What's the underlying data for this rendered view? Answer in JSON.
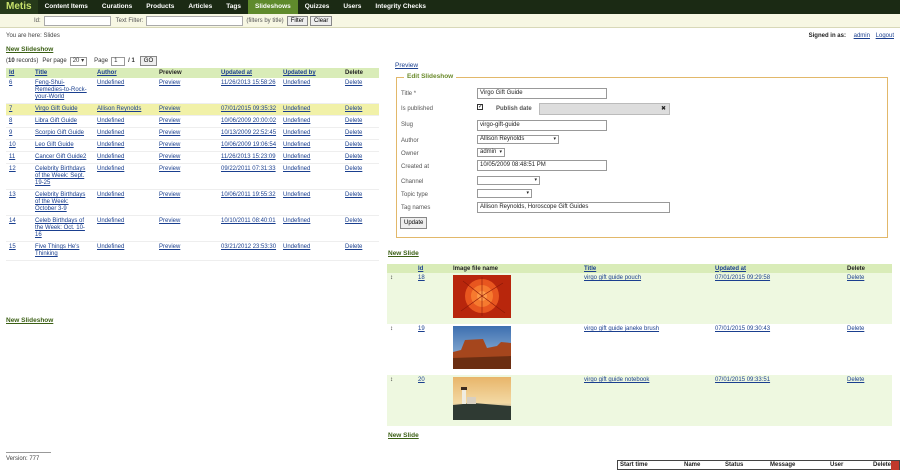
{
  "nav": {
    "brand": "Metis",
    "items": [
      "Content Items",
      "Curations",
      "Products",
      "Articles",
      "Tags",
      "Slideshows",
      "Quizzes",
      "Users",
      "Integrity Checks"
    ],
    "active": "Slideshows"
  },
  "filter": {
    "id_label": "Id:",
    "text_label": "Text Filter:",
    "hint": "(filters by title)",
    "filter_button": "Filter",
    "clear_button": "Clear"
  },
  "breadcrumb": "You are here: Slides",
  "signed_in": {
    "label": "Signed in as:",
    "user": "admin",
    "logout": "Logout"
  },
  "new_slideshow": "New Slideshow",
  "pager": {
    "records": "10",
    "records_suffix": " records)",
    "per_page_label": "Per page",
    "per_page": "20",
    "page_label": "Page",
    "page": "1",
    "page_total": "/ 1",
    "go": "GO"
  },
  "slideshow_table": {
    "headers": [
      "Id",
      "Title",
      "Author",
      "Preview",
      "Updated at",
      "Updated by",
      "Delete"
    ],
    "rows": [
      {
        "id": "6",
        "title": "Feng-Shui-Remedies-to-Rock-your-World",
        "author": "Undefined",
        "preview": "Preview",
        "updated": "11/26/2013 15:58:26",
        "by": "Undefined",
        "del": "Delete"
      },
      {
        "id": "7",
        "title": "Virgo Gift Guide",
        "author": "Allison Reynolds",
        "preview": "Preview",
        "updated": "07/01/2015 09:35:32",
        "by": "Undefined",
        "del": "Delete"
      },
      {
        "id": "8",
        "title": "Libra Gift Guide",
        "author": "Undefined",
        "preview": "Preview",
        "updated": "10/06/2009 20:00:02",
        "by": "Undefined",
        "del": "Delete"
      },
      {
        "id": "9",
        "title": "Scorpio Gift Guide",
        "author": "Undefined",
        "preview": "Preview",
        "updated": "10/13/2009 22:52:45",
        "by": "Undefined",
        "del": "Delete"
      },
      {
        "id": "10",
        "title": "Leo Gift Guide",
        "author": "Undefined",
        "preview": "Preview",
        "updated": "10/06/2009 19:06:54",
        "by": "Undefined",
        "del": "Delete"
      },
      {
        "id": "11",
        "title": "Cancer Gift Guide2",
        "author": "Undefined",
        "preview": "Preview",
        "updated": "11/26/2013 15:23:09",
        "by": "Undefined",
        "del": "Delete"
      },
      {
        "id": "12",
        "title": "Celebrity Birthdays of the Week: Sept. 19-25",
        "author": "Undefined",
        "preview": "Preview",
        "updated": "09/22/2011 07:31:33",
        "by": "Undefined",
        "del": "Delete"
      },
      {
        "id": "13",
        "title": "Celebrity Birthdays of the Week: October 3-9",
        "author": "Undefined",
        "preview": "Preview",
        "updated": "10/06/2011 19:55:32",
        "by": "Undefined",
        "del": "Delete"
      },
      {
        "id": "14",
        "title": "Celeb Birthdays of the Week: Oct. 10-16",
        "author": "Undefined",
        "preview": "Preview",
        "updated": "10/10/2011 08:40:01",
        "by": "Undefined",
        "del": "Delete"
      },
      {
        "id": "15",
        "title": "Five Things He's Thinking",
        "author": "Undefined",
        "preview": "Preview",
        "updated": "03/21/2012 23:53:30",
        "by": "Undefined",
        "del": "Delete"
      }
    ]
  },
  "edit": {
    "preview": "Preview",
    "legend": "Edit Slideshow",
    "title_label": "Title *",
    "title_value": "Virgo Gift Guide",
    "published_label": "Is published",
    "publish_date_label": "Publish date",
    "slug_label": "Slug",
    "slug_value": "virgo-gift-guide",
    "author_label": "Author",
    "author_value": "Allison Reynolds",
    "owner_label": "Owner",
    "owner_value": "admin",
    "created_label": "Created at",
    "created_value": "10/05/2009 08:48:51 PM",
    "channel_label": "Channel",
    "topic_label": "Topic type",
    "tags_label": "Tag names",
    "tags_value": "Allison Reynolds, Horoscope Gift Guides",
    "update_button": "Update"
  },
  "new_slide": "New Slide",
  "slides_table": {
    "headers": [
      "",
      "Id",
      "Image file name",
      "Title",
      "Updated at",
      "Delete"
    ],
    "rows": [
      {
        "id": "18",
        "title": "virgo gift guide pouch",
        "updated": "07/01/2015 09:29:58",
        "del": "Delete",
        "image": "orange-flower-photo"
      },
      {
        "id": "19",
        "title": "virgo gift guide janeke brush",
        "updated": "07/01/2015 09:30:43",
        "del": "Delete",
        "image": "desert-mesa-photo"
      },
      {
        "id": "20",
        "title": "virgo gift guide notebook",
        "updated": "07/01/2015 09:33:51",
        "del": "Delete",
        "image": "lighthouse-sunset-photo"
      }
    ]
  },
  "version": "Version: 777",
  "jobbar": [
    "Start time",
    "Name",
    "Status",
    "Message",
    "User",
    "Delete"
  ]
}
